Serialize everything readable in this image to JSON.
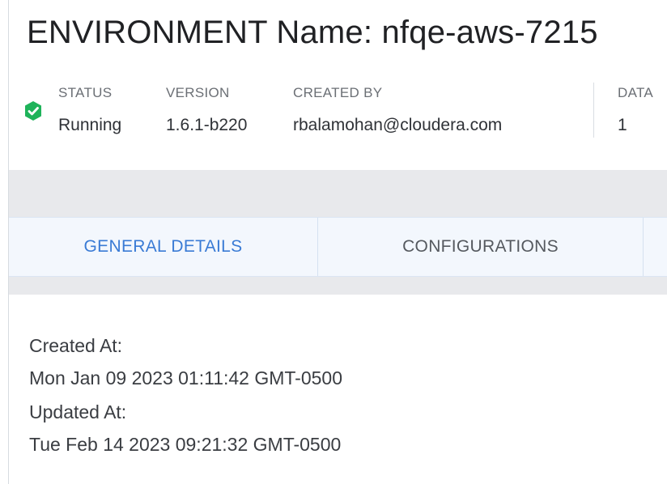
{
  "environment": {
    "title": "ENVIRONMENT Name: nfqe-aws-7215"
  },
  "meta": {
    "status_label": "STATUS",
    "status_value": "Running",
    "version_label": "VERSION",
    "version_value": "1.6.1-b220",
    "created_by_label": "CREATED BY",
    "created_by_value": "rbalamohan@cloudera.com",
    "data_label": "DATA",
    "data_value": "1",
    "status_icon": "check-badge-icon",
    "status_color": "#1fb35a"
  },
  "tabs": [
    {
      "label": "GENERAL DETAILS",
      "active": true
    },
    {
      "label": "CONFIGURATIONS",
      "active": false
    }
  ],
  "details": {
    "created_label": "Created At:",
    "created_value": "Mon Jan 09 2023 01:11:42 GMT-0500",
    "updated_label": "Updated At:",
    "updated_value": "Tue Feb 14 2023 09:21:32 GMT-0500"
  },
  "colors": {
    "accent": "#3a7bd5",
    "band": "#e8e9ec",
    "tab_bg": "#f3f7fd"
  }
}
